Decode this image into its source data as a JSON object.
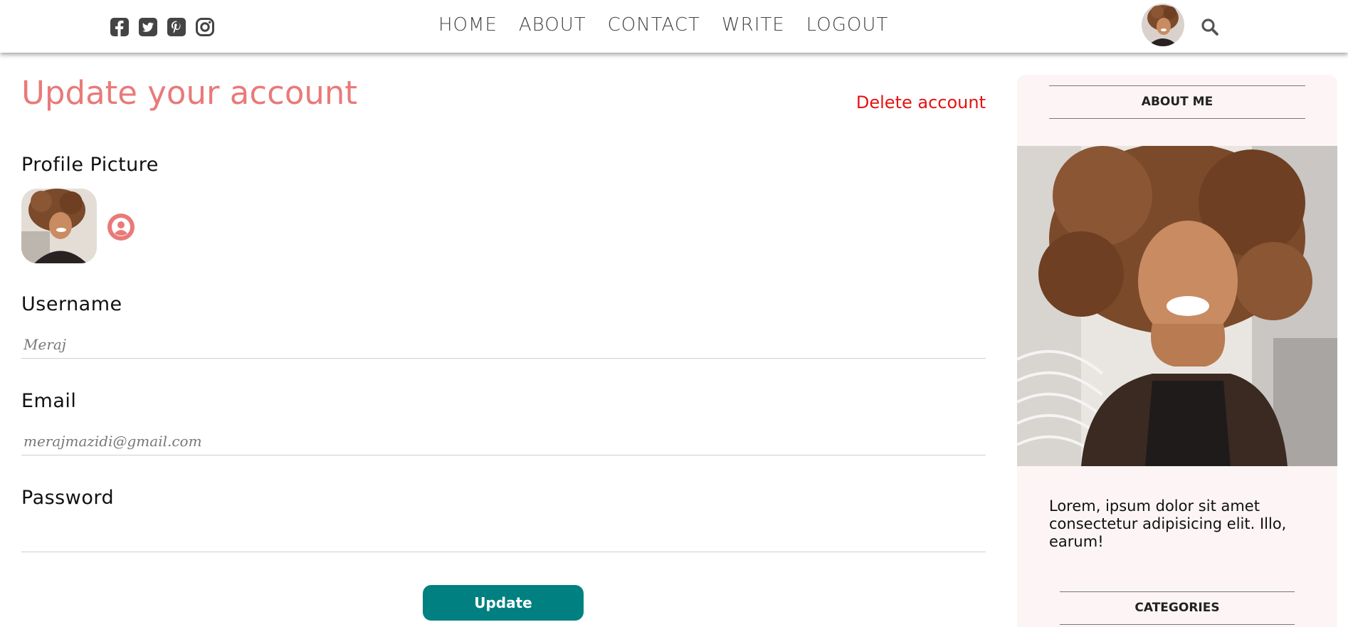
{
  "social": {
    "icons": [
      "facebook-square-icon",
      "twitter-square-icon",
      "pinterest-square-icon",
      "instagram-icon"
    ]
  },
  "nav": {
    "items": [
      "HOME",
      "ABOUT",
      "CONTACT",
      "WRITE",
      "LOGOUT"
    ]
  },
  "page": {
    "title": "Update your account",
    "delete_label": "Delete account"
  },
  "form": {
    "profile_label": "Profile Picture",
    "username_label": "Username",
    "username_placeholder": "Meraj",
    "email_label": "Email",
    "email_placeholder": "merajmazidi@gmail.com",
    "password_label": "Password",
    "password_placeholder": "",
    "update_label": "Update"
  },
  "sidebar": {
    "about_title": "ABOUT ME",
    "about_text": "Lorem, ipsum dolor sit amet consectetur adipisicing elit. Illo, earum!",
    "categories_title": "CATEGORIES"
  },
  "colors": {
    "accent": "#e97a7a",
    "danger": "#e51212",
    "button": "#008080",
    "sidebar_bg": "#fdf5f5"
  }
}
